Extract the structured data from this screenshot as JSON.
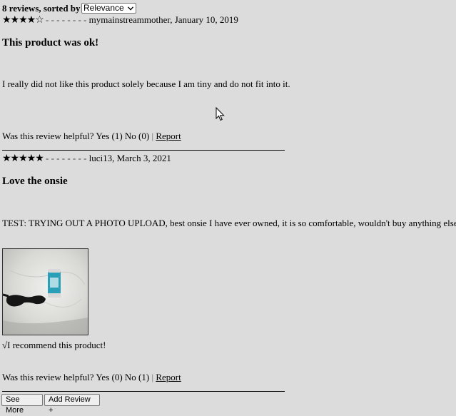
{
  "reviews_header": {
    "count_label": "8 reviews, sorted by",
    "sort_selected": "Relevance"
  },
  "reviews": [
    {
      "stars": "★★★★☆",
      "rating": 4,
      "dashes": "- - - - - - - -",
      "author_date": "mymainstreammother, January 10, 2019",
      "title": "This product was ok!",
      "body": "I really did not like this product solely because I am tiny and do not fit into it.",
      "helpful_prefix": "Was this review helpful?",
      "yes_label": "Yes (1)",
      "no_label": "No (0)",
      "separator": "|",
      "report_label": "Report"
    },
    {
      "stars": "★★★★★",
      "rating": 5,
      "dashes": "- - - - - - - -",
      "author_date": "luci13, March 3, 2021",
      "title": "Love the onsie",
      "body": "TEST: TRYING OUT A PHOTO UPLOAD, best onsie I have ever owned, it is so comfortable, wouldn't buy anything else, r",
      "recommend": "√I recommend this product!",
      "helpful_prefix": "Was this review helpful?",
      "yes_label": "Yes (0)",
      "no_label": "No (1)",
      "separator": "|",
      "report_label": "Report"
    }
  ],
  "footer": {
    "see_more_label": "See More",
    "add_review_label": "Add Review +"
  }
}
